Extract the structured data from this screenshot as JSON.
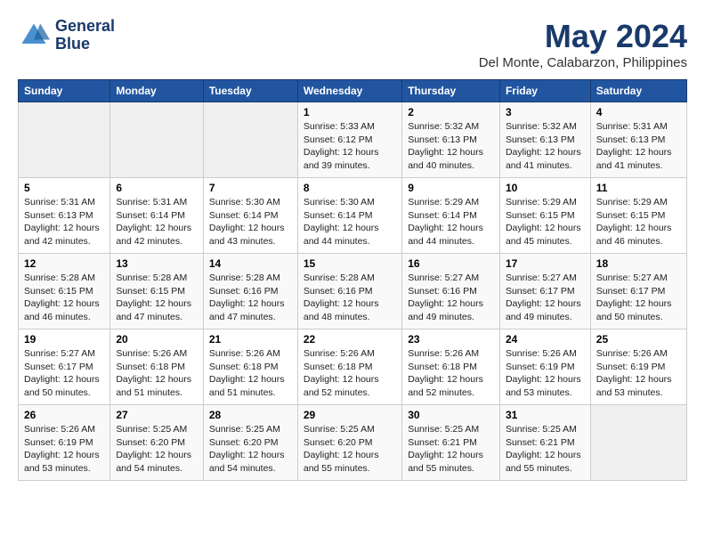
{
  "header": {
    "logo_line1": "General",
    "logo_line2": "Blue",
    "title": "May 2024",
    "subtitle": "Del Monte, Calabarzon, Philippines"
  },
  "columns": [
    "Sunday",
    "Monday",
    "Tuesday",
    "Wednesday",
    "Thursday",
    "Friday",
    "Saturday"
  ],
  "weeks": [
    [
      {
        "day": "",
        "sunrise": "",
        "sunset": "",
        "daylight": ""
      },
      {
        "day": "",
        "sunrise": "",
        "sunset": "",
        "daylight": ""
      },
      {
        "day": "",
        "sunrise": "",
        "sunset": "",
        "daylight": ""
      },
      {
        "day": "1",
        "sunrise": "Sunrise: 5:33 AM",
        "sunset": "Sunset: 6:12 PM",
        "daylight": "Daylight: 12 hours and 39 minutes."
      },
      {
        "day": "2",
        "sunrise": "Sunrise: 5:32 AM",
        "sunset": "Sunset: 6:13 PM",
        "daylight": "Daylight: 12 hours and 40 minutes."
      },
      {
        "day": "3",
        "sunrise": "Sunrise: 5:32 AM",
        "sunset": "Sunset: 6:13 PM",
        "daylight": "Daylight: 12 hours and 41 minutes."
      },
      {
        "day": "4",
        "sunrise": "Sunrise: 5:31 AM",
        "sunset": "Sunset: 6:13 PM",
        "daylight": "Daylight: 12 hours and 41 minutes."
      }
    ],
    [
      {
        "day": "5",
        "sunrise": "Sunrise: 5:31 AM",
        "sunset": "Sunset: 6:13 PM",
        "daylight": "Daylight: 12 hours and 42 minutes."
      },
      {
        "day": "6",
        "sunrise": "Sunrise: 5:31 AM",
        "sunset": "Sunset: 6:14 PM",
        "daylight": "Daylight: 12 hours and 42 minutes."
      },
      {
        "day": "7",
        "sunrise": "Sunrise: 5:30 AM",
        "sunset": "Sunset: 6:14 PM",
        "daylight": "Daylight: 12 hours and 43 minutes."
      },
      {
        "day": "8",
        "sunrise": "Sunrise: 5:30 AM",
        "sunset": "Sunset: 6:14 PM",
        "daylight": "Daylight: 12 hours and 44 minutes."
      },
      {
        "day": "9",
        "sunrise": "Sunrise: 5:29 AM",
        "sunset": "Sunset: 6:14 PM",
        "daylight": "Daylight: 12 hours and 44 minutes."
      },
      {
        "day": "10",
        "sunrise": "Sunrise: 5:29 AM",
        "sunset": "Sunset: 6:15 PM",
        "daylight": "Daylight: 12 hours and 45 minutes."
      },
      {
        "day": "11",
        "sunrise": "Sunrise: 5:29 AM",
        "sunset": "Sunset: 6:15 PM",
        "daylight": "Daylight: 12 hours and 46 minutes."
      }
    ],
    [
      {
        "day": "12",
        "sunrise": "Sunrise: 5:28 AM",
        "sunset": "Sunset: 6:15 PM",
        "daylight": "Daylight: 12 hours and 46 minutes."
      },
      {
        "day": "13",
        "sunrise": "Sunrise: 5:28 AM",
        "sunset": "Sunset: 6:15 PM",
        "daylight": "Daylight: 12 hours and 47 minutes."
      },
      {
        "day": "14",
        "sunrise": "Sunrise: 5:28 AM",
        "sunset": "Sunset: 6:16 PM",
        "daylight": "Daylight: 12 hours and 47 minutes."
      },
      {
        "day": "15",
        "sunrise": "Sunrise: 5:28 AM",
        "sunset": "Sunset: 6:16 PM",
        "daylight": "Daylight: 12 hours and 48 minutes."
      },
      {
        "day": "16",
        "sunrise": "Sunrise: 5:27 AM",
        "sunset": "Sunset: 6:16 PM",
        "daylight": "Daylight: 12 hours and 49 minutes."
      },
      {
        "day": "17",
        "sunrise": "Sunrise: 5:27 AM",
        "sunset": "Sunset: 6:17 PM",
        "daylight": "Daylight: 12 hours and 49 minutes."
      },
      {
        "day": "18",
        "sunrise": "Sunrise: 5:27 AM",
        "sunset": "Sunset: 6:17 PM",
        "daylight": "Daylight: 12 hours and 50 minutes."
      }
    ],
    [
      {
        "day": "19",
        "sunrise": "Sunrise: 5:27 AM",
        "sunset": "Sunset: 6:17 PM",
        "daylight": "Daylight: 12 hours and 50 minutes."
      },
      {
        "day": "20",
        "sunrise": "Sunrise: 5:26 AM",
        "sunset": "Sunset: 6:18 PM",
        "daylight": "Daylight: 12 hours and 51 minutes."
      },
      {
        "day": "21",
        "sunrise": "Sunrise: 5:26 AM",
        "sunset": "Sunset: 6:18 PM",
        "daylight": "Daylight: 12 hours and 51 minutes."
      },
      {
        "day": "22",
        "sunrise": "Sunrise: 5:26 AM",
        "sunset": "Sunset: 6:18 PM",
        "daylight": "Daylight: 12 hours and 52 minutes."
      },
      {
        "day": "23",
        "sunrise": "Sunrise: 5:26 AM",
        "sunset": "Sunset: 6:18 PM",
        "daylight": "Daylight: 12 hours and 52 minutes."
      },
      {
        "day": "24",
        "sunrise": "Sunrise: 5:26 AM",
        "sunset": "Sunset: 6:19 PM",
        "daylight": "Daylight: 12 hours and 53 minutes."
      },
      {
        "day": "25",
        "sunrise": "Sunrise: 5:26 AM",
        "sunset": "Sunset: 6:19 PM",
        "daylight": "Daylight: 12 hours and 53 minutes."
      }
    ],
    [
      {
        "day": "26",
        "sunrise": "Sunrise: 5:26 AM",
        "sunset": "Sunset: 6:19 PM",
        "daylight": "Daylight: 12 hours and 53 minutes."
      },
      {
        "day": "27",
        "sunrise": "Sunrise: 5:25 AM",
        "sunset": "Sunset: 6:20 PM",
        "daylight": "Daylight: 12 hours and 54 minutes."
      },
      {
        "day": "28",
        "sunrise": "Sunrise: 5:25 AM",
        "sunset": "Sunset: 6:20 PM",
        "daylight": "Daylight: 12 hours and 54 minutes."
      },
      {
        "day": "29",
        "sunrise": "Sunrise: 5:25 AM",
        "sunset": "Sunset: 6:20 PM",
        "daylight": "Daylight: 12 hours and 55 minutes."
      },
      {
        "day": "30",
        "sunrise": "Sunrise: 5:25 AM",
        "sunset": "Sunset: 6:21 PM",
        "daylight": "Daylight: 12 hours and 55 minutes."
      },
      {
        "day": "31",
        "sunrise": "Sunrise: 5:25 AM",
        "sunset": "Sunset: 6:21 PM",
        "daylight": "Daylight: 12 hours and 55 minutes."
      },
      {
        "day": "",
        "sunrise": "",
        "sunset": "",
        "daylight": ""
      }
    ]
  ]
}
